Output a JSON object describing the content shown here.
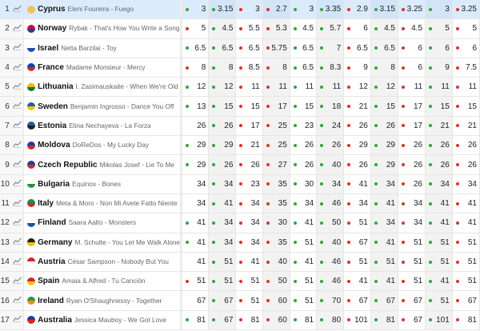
{
  "colors": {
    "dot_green": "#2aa83a",
    "dot_red": "#d9332f",
    "highlight": "#dcebfb"
  },
  "icon": "line-chart-icon",
  "rows": [
    {
      "rank": "1",
      "country": "Cyprus",
      "song": "Eleni Foureira - Fuego",
      "flag": [
        "#f2c15b",
        "#f2c15b"
      ],
      "highlight": true,
      "odds": [
        {
          "v": "3",
          "d": "g"
        },
        {
          "v": "3.15",
          "d": "g"
        },
        {
          "v": "3",
          "d": "r"
        },
        {
          "v": "2.7",
          "d": "r"
        },
        {
          "v": "3",
          "d": "g"
        },
        {
          "v": "3.35",
          "d": "g"
        },
        {
          "v": "2.9",
          "d": "r"
        },
        {
          "v": "3.15",
          "d": "g"
        },
        {
          "v": "3.25",
          "d": "r"
        },
        {
          "v": "3",
          "d": "g"
        },
        {
          "v": "3.25",
          "d": "r"
        }
      ]
    },
    {
      "rank": "2",
      "country": "Norway",
      "song": "Rybak - That's How You Write a Song",
      "flag": [
        "#c8102e",
        "#1f3f8a"
      ],
      "odds": [
        {
          "v": "5",
          "d": "r"
        },
        {
          "v": "4.5",
          "d": "g"
        },
        {
          "v": "5.5",
          "d": "r"
        },
        {
          "v": "5.3",
          "d": "r"
        },
        {
          "v": "4.5",
          "d": "g"
        },
        {
          "v": "5.7",
          "d": "g"
        },
        {
          "v": "6",
          "d": "r"
        },
        {
          "v": "4.5",
          "d": "g"
        },
        {
          "v": "4.5",
          "d": "r"
        },
        {
          "v": "5",
          "d": "g"
        },
        {
          "v": "5",
          "d": "r"
        }
      ]
    },
    {
      "rank": "3",
      "country": "Israel",
      "song": "Netta Barzilai - Toy",
      "flag": [
        "#ffffff",
        "#1e4fb5"
      ],
      "odds": [
        {
          "v": "6.5",
          "d": "g"
        },
        {
          "v": "6.5",
          "d": "g"
        },
        {
          "v": "6.5",
          "d": "r"
        },
        {
          "v": "5.75",
          "d": "r"
        },
        {
          "v": "6.5",
          "d": "g"
        },
        {
          "v": "7",
          "d": "g"
        },
        {
          "v": "6.5",
          "d": "r"
        },
        {
          "v": "6.5",
          "d": "g"
        },
        {
          "v": "6",
          "d": "r"
        },
        {
          "v": "6",
          "d": "g"
        },
        {
          "v": "6",
          "d": "r"
        }
      ]
    },
    {
      "rank": "4",
      "country": "France",
      "song": "Madame Monsieur - Mercy",
      "flag": [
        "#1e3fa0",
        "#d22730"
      ],
      "odds": [
        {
          "v": "8",
          "d": "r"
        },
        {
          "v": "8",
          "d": "g"
        },
        {
          "v": "8.5",
          "d": "r"
        },
        {
          "v": "8",
          "d": "r"
        },
        {
          "v": "6.5",
          "d": "g"
        },
        {
          "v": "8.3",
          "d": "g"
        },
        {
          "v": "9",
          "d": "r"
        },
        {
          "v": "8",
          "d": "g"
        },
        {
          "v": "6",
          "d": "r"
        },
        {
          "v": "9",
          "d": "g"
        },
        {
          "v": "7.5",
          "d": "r"
        }
      ]
    },
    {
      "rank": "5",
      "country": "Lithuania",
      "song": "I. Zasimauskaite - When We're Old",
      "flag": [
        "#f2b800",
        "#0a7a33"
      ],
      "odds": [
        {
          "v": "12",
          "d": "g"
        },
        {
          "v": "12",
          "d": "g"
        },
        {
          "v": "11",
          "d": "r"
        },
        {
          "v": "11",
          "d": "r"
        },
        {
          "v": "11",
          "d": "g"
        },
        {
          "v": "11",
          "d": "g"
        },
        {
          "v": "12",
          "d": "r"
        },
        {
          "v": "12",
          "d": "g"
        },
        {
          "v": "11",
          "d": "r"
        },
        {
          "v": "11",
          "d": "g"
        },
        {
          "v": "11",
          "d": "r"
        }
      ]
    },
    {
      "rank": "6",
      "country": "Sweden",
      "song": "Benjamin Ingrosso - Dance You Off",
      "flag": [
        "#1f5fa8",
        "#f5c400"
      ],
      "odds": [
        {
          "v": "13",
          "d": "g"
        },
        {
          "v": "15",
          "d": "g"
        },
        {
          "v": "15",
          "d": "r"
        },
        {
          "v": "17",
          "d": "r"
        },
        {
          "v": "15",
          "d": "g"
        },
        {
          "v": "18",
          "d": "g"
        },
        {
          "v": "21",
          "d": "r"
        },
        {
          "v": "15",
          "d": "g"
        },
        {
          "v": "17",
          "d": "r"
        },
        {
          "v": "15",
          "d": "g"
        },
        {
          "v": "15",
          "d": "r"
        }
      ]
    },
    {
      "rank": "7",
      "country": "Estonia",
      "song": "Elina Nechayeva - La Forza",
      "flag": [
        "#1f5fa8",
        "#222222"
      ],
      "odds": [
        {
          "v": "26",
          "d": ""
        },
        {
          "v": "26",
          "d": "g"
        },
        {
          "v": "17",
          "d": "r"
        },
        {
          "v": "25",
          "d": "r"
        },
        {
          "v": "23",
          "d": "g"
        },
        {
          "v": "24",
          "d": "g"
        },
        {
          "v": "26",
          "d": "r"
        },
        {
          "v": "26",
          "d": "g"
        },
        {
          "v": "17",
          "d": "r"
        },
        {
          "v": "21",
          "d": "g"
        },
        {
          "v": "21",
          "d": "r"
        }
      ]
    },
    {
      "rank": "8",
      "country": "Moldova",
      "song": "DoReDos - My Lucky Day",
      "flag": [
        "#1f3f9a",
        "#d22730"
      ],
      "odds": [
        {
          "v": "29",
          "d": "g"
        },
        {
          "v": "29",
          "d": "g"
        },
        {
          "v": "21",
          "d": "r"
        },
        {
          "v": "25",
          "d": "r"
        },
        {
          "v": "26",
          "d": "g"
        },
        {
          "v": "26",
          "d": "g"
        },
        {
          "v": "29",
          "d": "r"
        },
        {
          "v": "29",
          "d": "g"
        },
        {
          "v": "26",
          "d": "r"
        },
        {
          "v": "26",
          "d": "g"
        },
        {
          "v": "26",
          "d": "r"
        }
      ]
    },
    {
      "rank": "9",
      "country": "Czech Republic",
      "song": "Mikolas Josef - Lie To Me",
      "flag": [
        "#1f3f9a",
        "#d22730"
      ],
      "odds": [
        {
          "v": "29",
          "d": "g"
        },
        {
          "v": "26",
          "d": "g"
        },
        {
          "v": "26",
          "d": "r"
        },
        {
          "v": "27",
          "d": "r"
        },
        {
          "v": "26",
          "d": "g"
        },
        {
          "v": "40",
          "d": "g"
        },
        {
          "v": "26",
          "d": "r"
        },
        {
          "v": "29",
          "d": "g"
        },
        {
          "v": "26",
          "d": "r"
        },
        {
          "v": "26",
          "d": "g"
        },
        {
          "v": "26",
          "d": "r"
        }
      ]
    },
    {
      "rank": "10",
      "country": "Bulgaria",
      "song": "Equinox - Bones",
      "flag": [
        "#ffffff",
        "#2f8f3f"
      ],
      "odds": [
        {
          "v": "34",
          "d": ""
        },
        {
          "v": "34",
          "d": "g"
        },
        {
          "v": "23",
          "d": "r"
        },
        {
          "v": "35",
          "d": "r"
        },
        {
          "v": "30",
          "d": "g"
        },
        {
          "v": "34",
          "d": "g"
        },
        {
          "v": "41",
          "d": "r"
        },
        {
          "v": "34",
          "d": "g"
        },
        {
          "v": "26",
          "d": "r"
        },
        {
          "v": "34",
          "d": "g"
        },
        {
          "v": "34",
          "d": "r"
        }
      ]
    },
    {
      "rank": "11",
      "country": "Italy",
      "song": "Meta & Moro - Non Mi Avete Fatto Niente",
      "flag": [
        "#2a8a3a",
        "#d22730"
      ],
      "odds": [
        {
          "v": "34",
          "d": ""
        },
        {
          "v": "41",
          "d": "g"
        },
        {
          "v": "34",
          "d": "r"
        },
        {
          "v": "35",
          "d": "r"
        },
        {
          "v": "34",
          "d": "g"
        },
        {
          "v": "46",
          "d": "g"
        },
        {
          "v": "34",
          "d": "r"
        },
        {
          "v": "41",
          "d": "g"
        },
        {
          "v": "34",
          "d": "r"
        },
        {
          "v": "41",
          "d": "g"
        },
        {
          "v": "41",
          "d": "r"
        }
      ]
    },
    {
      "rank": "12",
      "country": "Finland",
      "song": "Saara Aalto - Monsters",
      "flag": [
        "#ffffff",
        "#1f4fa8"
      ],
      "odds": [
        {
          "v": "41",
          "d": "g"
        },
        {
          "v": "34",
          "d": "g"
        },
        {
          "v": "34",
          "d": "r"
        },
        {
          "v": "30",
          "d": "r"
        },
        {
          "v": "41",
          "d": "g"
        },
        {
          "v": "50",
          "d": "g"
        },
        {
          "v": "51",
          "d": "r"
        },
        {
          "v": "34",
          "d": "g"
        },
        {
          "v": "34",
          "d": "r"
        },
        {
          "v": "41",
          "d": "g"
        },
        {
          "v": "41",
          "d": "r"
        }
      ]
    },
    {
      "rank": "13",
      "country": "Germany",
      "song": "M. Schulte - You Let Me Walk Alone",
      "flag": [
        "#222222",
        "#f2c200"
      ],
      "odds": [
        {
          "v": "41",
          "d": "g"
        },
        {
          "v": "34",
          "d": "g"
        },
        {
          "v": "34",
          "d": "r"
        },
        {
          "v": "35",
          "d": "r"
        },
        {
          "v": "51",
          "d": "g"
        },
        {
          "v": "40",
          "d": "g"
        },
        {
          "v": "67",
          "d": "r"
        },
        {
          "v": "41",
          "d": "g"
        },
        {
          "v": "51",
          "d": "r"
        },
        {
          "v": "51",
          "d": "g"
        },
        {
          "v": "51",
          "d": "r"
        }
      ]
    },
    {
      "rank": "14",
      "country": "Austria",
      "song": "César Sampson - Nobody But You",
      "flag": [
        "#d22730",
        "#ffffff"
      ],
      "odds": [
        {
          "v": "41",
          "d": ""
        },
        {
          "v": "51",
          "d": "g"
        },
        {
          "v": "41",
          "d": "r"
        },
        {
          "v": "40",
          "d": "r"
        },
        {
          "v": "41",
          "d": "g"
        },
        {
          "v": "46",
          "d": "g"
        },
        {
          "v": "51",
          "d": "r"
        },
        {
          "v": "51",
          "d": "g"
        },
        {
          "v": "51",
          "d": "r"
        },
        {
          "v": "51",
          "d": "g"
        },
        {
          "v": "51",
          "d": "r"
        }
      ]
    },
    {
      "rank": "15",
      "country": "Spain",
      "song": "Amaia & Alfred - Tu Canción",
      "flag": [
        "#d22730",
        "#f5c400"
      ],
      "odds": [
        {
          "v": "51",
          "d": "r"
        },
        {
          "v": "51",
          "d": "g"
        },
        {
          "v": "51",
          "d": "r"
        },
        {
          "v": "50",
          "d": "r"
        },
        {
          "v": "51",
          "d": "g"
        },
        {
          "v": "46",
          "d": "g"
        },
        {
          "v": "41",
          "d": "r"
        },
        {
          "v": "41",
          "d": "g"
        },
        {
          "v": "51",
          "d": "r"
        },
        {
          "v": "41",
          "d": "g"
        },
        {
          "v": "51",
          "d": "r"
        }
      ]
    },
    {
      "rank": "16",
      "country": "Ireland",
      "song": "Ryan O'Shaughnessy - Together",
      "flag": [
        "#1f9a4a",
        "#f28c1e"
      ],
      "odds": [
        {
          "v": "67",
          "d": ""
        },
        {
          "v": "67",
          "d": "g"
        },
        {
          "v": "51",
          "d": "r"
        },
        {
          "v": "60",
          "d": "r"
        },
        {
          "v": "51",
          "d": "g"
        },
        {
          "v": "70",
          "d": "g"
        },
        {
          "v": "67",
          "d": "r"
        },
        {
          "v": "67",
          "d": "g"
        },
        {
          "v": "67",
          "d": "r"
        },
        {
          "v": "51",
          "d": "g"
        },
        {
          "v": "67",
          "d": "r"
        }
      ]
    },
    {
      "rank": "17",
      "country": "Australia",
      "song": "Jessica Mauboy - We Got Love",
      "flag": [
        "#1f3f9a",
        "#d22730"
      ],
      "odds": [
        {
          "v": "81",
          "d": "g"
        },
        {
          "v": "67",
          "d": "g"
        },
        {
          "v": "81",
          "d": "r"
        },
        {
          "v": "60",
          "d": "r"
        },
        {
          "v": "81",
          "d": "g"
        },
        {
          "v": "80",
          "d": "g"
        },
        {
          "v": "101",
          "d": "r"
        },
        {
          "v": "81",
          "d": "g"
        },
        {
          "v": "67",
          "d": "r"
        },
        {
          "v": "101",
          "d": "g"
        },
        {
          "v": "81",
          "d": "r"
        }
      ]
    }
  ]
}
